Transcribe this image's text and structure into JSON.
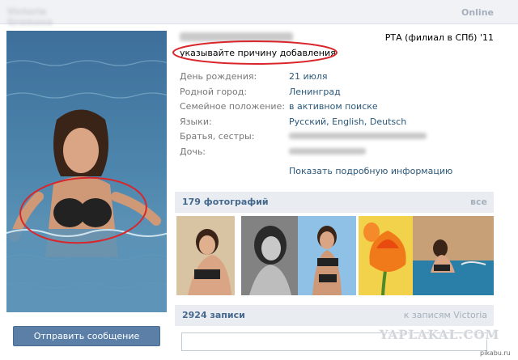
{
  "topbar": {
    "name": "Victoria Gromova",
    "online": "Online"
  },
  "profile": {
    "status": "указывайте причину добавления",
    "education": "РТА (филиал в СПб) '11",
    "info": [
      {
        "label": "День рождения:",
        "value": "21 июля"
      },
      {
        "label": "Родной город:",
        "value": "Ленинград"
      },
      {
        "label": "Семейное положение:",
        "value": "в активном поиске"
      },
      {
        "label": "Языки:",
        "value": "Русский, English, Deutsch"
      },
      {
        "label": "Братья, сестры:",
        "value": ""
      },
      {
        "label": "Дочь:",
        "value": ""
      }
    ],
    "more": "Показать подробную информацию"
  },
  "actions": {
    "send_message": "Отправить сообщение"
  },
  "photos": {
    "title": "179 фотографий",
    "all": "все"
  },
  "posts": {
    "title": "2924 записи",
    "link": "к записям Victoria"
  },
  "watermark": {
    "main": "YAPLAKAL.COM",
    "small": "pikabu.ru"
  },
  "colors": {
    "link": "#2b587a",
    "header_bg": "#e9edf1",
    "header_text": "#45688e",
    "button": "#5b7fa6",
    "annotation": "#d9262b"
  }
}
